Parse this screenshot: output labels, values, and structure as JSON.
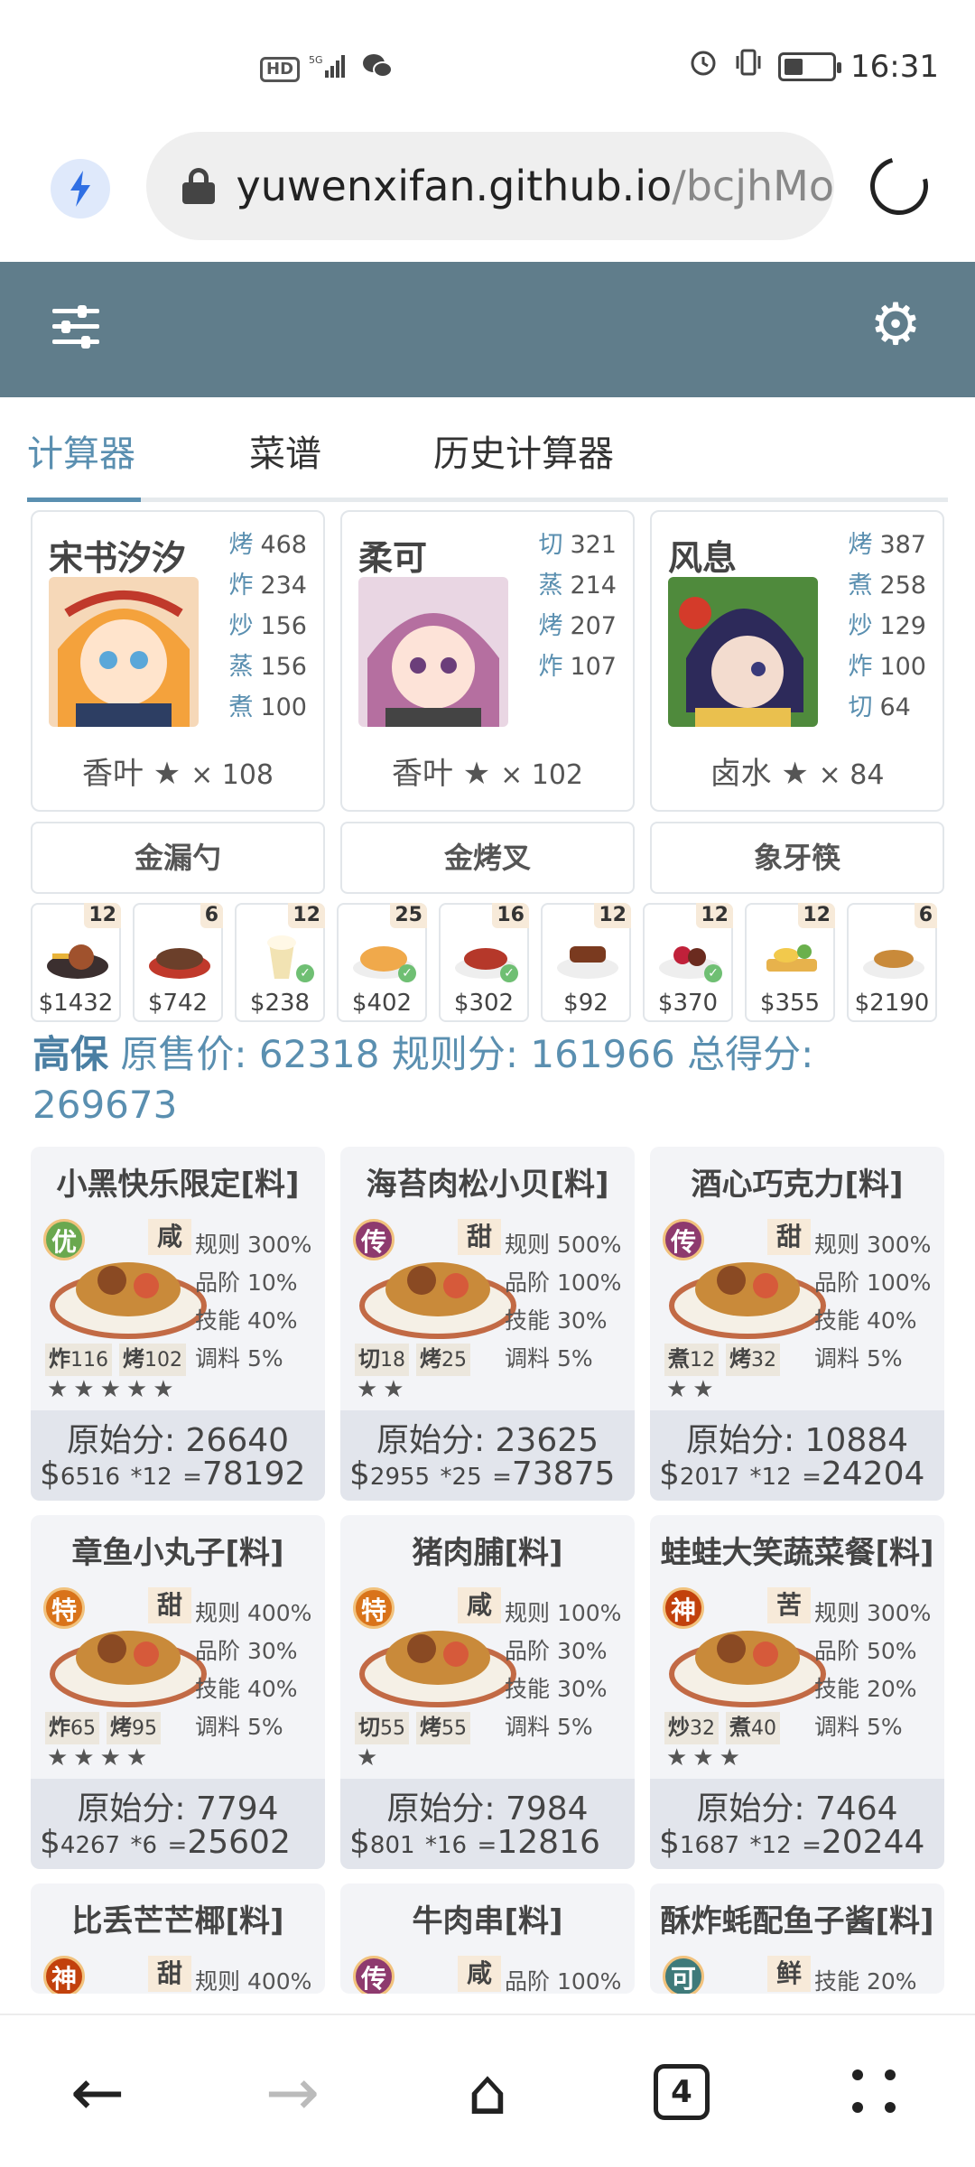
{
  "status": {
    "hd": "HD",
    "signal": "5G",
    "time": "16:31"
  },
  "browser": {
    "url_main": "yuwenxifan.github.io",
    "url_rest": "/bcjhMo",
    "tabs_count": "4"
  },
  "tabs": [
    "计算器",
    "菜谱",
    "历史计算器"
  ],
  "chefs": [
    {
      "name": "宋书汐汐",
      "skills": [
        [
          "烤",
          "468"
        ],
        [
          "炸",
          "234"
        ],
        [
          "炒",
          "156"
        ],
        [
          "蒸",
          "156"
        ],
        [
          "煮",
          "100"
        ]
      ],
      "equip": "香叶 ★",
      "mult": "× 108",
      "tool": "金漏勺"
    },
    {
      "name": "柔可",
      "skills": [
        [
          "切",
          "321"
        ],
        [
          "蒸",
          "214"
        ],
        [
          "烤",
          "207"
        ],
        [
          "炸",
          "107"
        ]
      ],
      "equip": "香叶 ★",
      "mult": "× 102",
      "tool": "金烤叉"
    },
    {
      "name": "风息",
      "skills": [
        [
          "烤",
          "387"
        ],
        [
          "煮",
          "258"
        ],
        [
          "炒",
          "129"
        ],
        [
          "炸",
          "100"
        ],
        [
          "切",
          "64"
        ]
      ],
      "equip": "卤水 ★",
      "mult": "× 84",
      "tool": "象牙筷"
    }
  ],
  "strip": [
    {
      "qty": "12",
      "price": "$1432",
      "checked": false
    },
    {
      "qty": "6",
      "price": "$742",
      "checked": false
    },
    {
      "qty": "12",
      "price": "$238",
      "checked": true
    },
    {
      "qty": "25",
      "price": "$402",
      "checked": true
    },
    {
      "qty": "16",
      "price": "$302",
      "checked": true
    },
    {
      "qty": "12",
      "price": "$92",
      "checked": false
    },
    {
      "qty": "12",
      "price": "$370",
      "checked": true
    },
    {
      "qty": "12",
      "price": "$355",
      "checked": false
    },
    {
      "qty": "6",
      "price": "$2190",
      "checked": false
    }
  ],
  "summary": {
    "label": "高保",
    "orig_label": "原售价:",
    "orig_value": "62318",
    "rule_label": "规则分:",
    "rule_value": "161966",
    "total_label": "总得分:",
    "total_value": "269673"
  },
  "recipes": [
    {
      "title": "小黑快乐限定[料]",
      "badge": "优",
      "badge_color": "#6aa84f",
      "taste": "咸",
      "stats": [
        "规则 300%",
        "品阶 10%",
        "技能 40%",
        "调料 5%"
      ],
      "skills": [
        [
          "炸",
          "116"
        ],
        [
          "烤",
          "102"
        ]
      ],
      "stars": "★★★★★",
      "orig": "原始分: 26640",
      "price": "6516",
      "count": "*12",
      "total": "78192"
    },
    {
      "title": "海苔肉松小贝[料]",
      "badge": "传",
      "badge_color": "#8e3a6e",
      "taste": "甜",
      "stats": [
        "规则 500%",
        "品阶 100%",
        "技能 30%",
        "调料 5%"
      ],
      "skills": [
        [
          "切",
          "18"
        ],
        [
          "烤",
          "25"
        ]
      ],
      "stars": "★★",
      "orig": "原始分: 23625",
      "price": "2955",
      "count": "*25",
      "total": "73875"
    },
    {
      "title": "酒心巧克力[料]",
      "badge": "传",
      "badge_color": "#8e3a6e",
      "taste": "甜",
      "stats": [
        "规则 300%",
        "品阶 100%",
        "技能 40%",
        "调料 5%"
      ],
      "skills": [
        [
          "煮",
          "12"
        ],
        [
          "烤",
          "32"
        ]
      ],
      "stars": "★★",
      "orig": "原始分: 10884",
      "price": "2017",
      "count": "*12",
      "total": "24204"
    },
    {
      "title": "章鱼小丸子[料]",
      "badge": "特",
      "badge_color": "#d9731a",
      "taste": "甜",
      "stats": [
        "规则 400%",
        "品阶 30%",
        "技能 40%",
        "调料 5%"
      ],
      "skills": [
        [
          "炸",
          "65"
        ],
        [
          "烤",
          "95"
        ]
      ],
      "stars": "★★★★",
      "orig": "原始分: 7794",
      "price": "4267",
      "count": "*6",
      "total": "25602"
    },
    {
      "title": "猪肉脯[料]",
      "badge": "特",
      "badge_color": "#d9731a",
      "taste": "咸",
      "stats": [
        "规则 100%",
        "品阶 30%",
        "技能 30%",
        "调料 5%"
      ],
      "skills": [
        [
          "切",
          "55"
        ],
        [
          "烤",
          "55"
        ]
      ],
      "stars": "★",
      "orig": "原始分: 7984",
      "price": "801",
      "count": "*16",
      "total": "12816"
    },
    {
      "title": "蛙蛙大笑蔬菜餐[料]",
      "badge": "神",
      "badge_color": "#c2410c",
      "taste": "苦",
      "stats": [
        "规则 300%",
        "品阶 50%",
        "技能 20%",
        "调料 5%"
      ],
      "skills": [
        [
          "炒",
          "32"
        ],
        [
          "煮",
          "40"
        ]
      ],
      "stars": "★★★",
      "orig": "原始分: 7464",
      "price": "1687",
      "count": "*12",
      "total": "20244"
    },
    {
      "title": "比丢芒芒椰[料]",
      "badge": "神",
      "badge_color": "#c2410c",
      "taste": "甜",
      "stats": [
        "规则 400%"
      ],
      "skills": [],
      "stars": "",
      "orig": "",
      "price": "",
      "count": "",
      "total": ""
    },
    {
      "title": "牛肉串[料]",
      "badge": "传",
      "badge_color": "#8e3a6e",
      "taste": "咸",
      "stats": [
        "品阶 100%"
      ],
      "skills": [],
      "stars": "",
      "orig": "",
      "price": "",
      "count": "",
      "total": ""
    },
    {
      "title": "酥炸蚝配鱼子酱[料]",
      "badge": "可",
      "badge_color": "#3f7a7a",
      "taste": "鲜",
      "stats": [
        "技能 20%"
      ],
      "skills": [],
      "stars": "",
      "orig": "",
      "price": "",
      "count": "",
      "total": ""
    }
  ]
}
